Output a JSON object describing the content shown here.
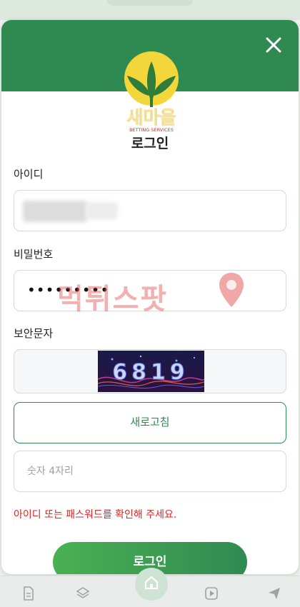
{
  "modal": {
    "title": "로그인",
    "id_label": "아이디",
    "password_label": "비밀번호",
    "password_mask": "•••••••••",
    "captcha_label": "보안문자",
    "captcha_code": "6819",
    "refresh_label": "새로고침",
    "captcha_placeholder": "숫자 4자리",
    "error_message": "아이디 또는 패스워드를 확인해 주세요.",
    "login_label": "로그인"
  },
  "logo": {
    "brand_text": "새마을",
    "sub_text": "BETTING SERVICES"
  },
  "watermark": {
    "text": "먹튀스팟"
  },
  "colors": {
    "header_green": "#2f8a52",
    "error_red": "#e02424",
    "logo_yellow": "#f2d63a"
  },
  "bottom_nav": {
    "icons": [
      "document-icon",
      "layers-icon",
      "home-icon",
      "play-icon",
      "send-icon"
    ]
  }
}
